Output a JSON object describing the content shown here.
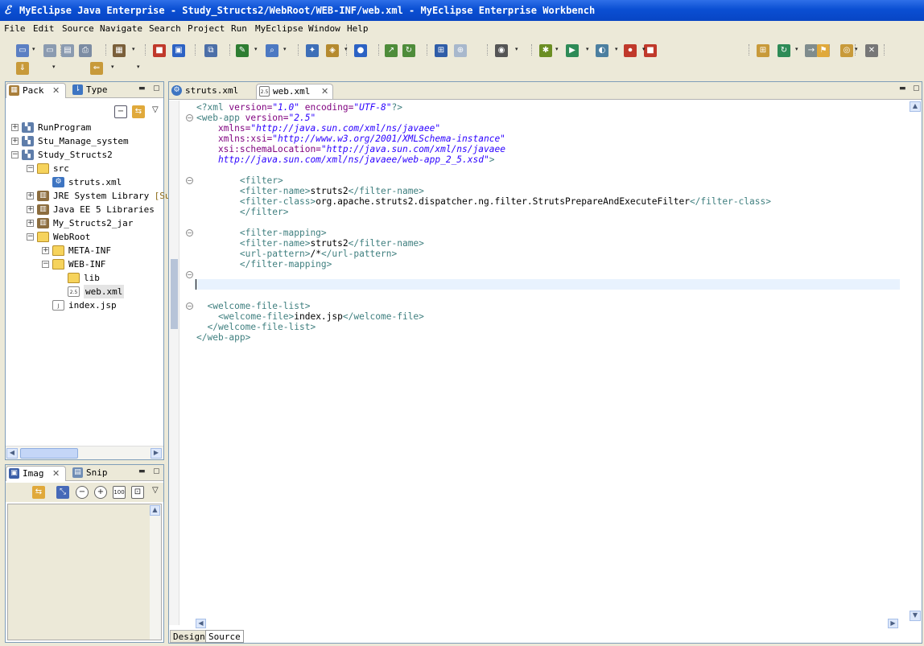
{
  "window": {
    "title": "MyEclipse Java Enterprise - Study_Structs2/WebRoot/WEB-INF/web.xml - MyEclipse Enterprise Workbench"
  },
  "menu": [
    "File",
    "Edit",
    "Source",
    "Navigate",
    "Search",
    "Project",
    "Run",
    "MyEclipse",
    "Window",
    "Help"
  ],
  "toolbar_icons": [
    "new-icon",
    "save-icon",
    "save-all-icon",
    "print-icon",
    "deploy-icon",
    "package-icon",
    "jar-icon",
    "server-icon",
    "debug-build-icon",
    "search-icon",
    "open-type-icon",
    "new-class-icon",
    "globe-icon",
    "open-resource-icon",
    "external-tools-icon",
    "properties-icon",
    "browser-icon",
    "camera-icon",
    "bug-debug-icon",
    "run-icon",
    "coverage-icon",
    "profile-icon",
    "stop-icon",
    "perspective-icon",
    "refresh-icon",
    "forward-icon",
    "back-icon",
    "open-folder-icon",
    "wizard-icon",
    "open-icon",
    "close-icon"
  ],
  "package_explorer": {
    "tabs": [
      {
        "label": "Pack",
        "icon": "package-explorer-icon"
      },
      {
        "label": "Type",
        "icon": "type-hierarchy-icon"
      }
    ],
    "tree": [
      {
        "label": "RunProgram",
        "level": 0,
        "expander": "+",
        "icon": "project-icon"
      },
      {
        "label": "Stu_Manage_system",
        "level": 0,
        "expander": "+",
        "icon": "project-icon"
      },
      {
        "label": "Study_Structs2",
        "level": 0,
        "expander": "-",
        "icon": "project-icon"
      },
      {
        "label": "src",
        "level": 1,
        "expander": "-",
        "icon": "source-folder-icon"
      },
      {
        "label": "struts.xml",
        "level": 2,
        "expander": "",
        "icon": "xml-gear-icon"
      },
      {
        "label": "JRE System Library",
        "suffix": "[Su",
        "level": 1,
        "expander": "+",
        "icon": "library-icon"
      },
      {
        "label": "Java EE 5 Libraries",
        "level": 1,
        "expander": "+",
        "icon": "library-icon"
      },
      {
        "label": "My_Structs2_jar",
        "level": 1,
        "expander": "+",
        "icon": "library-icon"
      },
      {
        "label": "WebRoot",
        "level": 1,
        "expander": "-",
        "icon": "folder-icon"
      },
      {
        "label": "META-INF",
        "level": 2,
        "expander": "+",
        "icon": "folder-icon"
      },
      {
        "label": "WEB-INF",
        "level": 2,
        "expander": "-",
        "icon": "folder-icon"
      },
      {
        "label": "lib",
        "level": 3,
        "expander": "",
        "icon": "folder-icon"
      },
      {
        "label": "web.xml",
        "level": 3,
        "expander": "",
        "icon": "web-xml-icon",
        "selected": true
      },
      {
        "label": "index.jsp",
        "level": 2,
        "expander": "",
        "icon": "jsp-file-icon"
      }
    ]
  },
  "image_panel": {
    "tabs": [
      {
        "label": "Imag",
        "icon": "image-view-icon"
      },
      {
        "label": "Snip",
        "icon": "snippets-icon"
      }
    ],
    "tools": [
      "link-icon",
      "fit-icon",
      "zoom-out-icon",
      "zoom-in-icon",
      "actual-size-icon",
      "fit-screen-icon",
      "view-menu-icon"
    ]
  },
  "editor": {
    "tabs": [
      {
        "label": "struts.xml",
        "icon": "xml-gear-icon",
        "active": false
      },
      {
        "label": "web.xml",
        "icon": "web-xml-icon",
        "active": true
      }
    ],
    "bottom_tabs": [
      {
        "label": "Design",
        "active": false
      },
      {
        "label": "Source",
        "active": true
      }
    ],
    "current_line": 17,
    "lines": [
      [
        {
          "t": "<?xml ",
          "c": "tag"
        },
        {
          "t": "version=",
          "c": "attr"
        },
        {
          "t": "\"1.0\"",
          "c": "val"
        },
        {
          "t": " encoding=",
          "c": "attr"
        },
        {
          "t": "\"UTF-8\"",
          "c": "val"
        },
        {
          "t": "?>",
          "c": "tag"
        }
      ],
      [
        {
          "t": "<web-app ",
          "c": "tag"
        },
        {
          "t": "version=",
          "c": "attr"
        },
        {
          "t": "\"2.5\"",
          "c": "val"
        }
      ],
      [
        {
          "t": "    xmlns=",
          "c": "attr"
        },
        {
          "t": "\"http://java.sun.com/xml/ns/javaee\"",
          "c": "val"
        }
      ],
      [
        {
          "t": "    xmlns:xsi=",
          "c": "attr"
        },
        {
          "t": "\"http://www.w3.org/2001/XMLSchema-instance\"",
          "c": "val"
        }
      ],
      [
        {
          "t": "    xsi:schemaLocation=",
          "c": "attr"
        },
        {
          "t": "\"http://java.sun.com/xml/ns/javaee",
          "c": "val"
        }
      ],
      [
        {
          "t": "    http://java.sun.com/xml/ns/javaee/web-app_2_5.xsd\"",
          "c": "val"
        },
        {
          "t": ">",
          "c": "tag"
        }
      ],
      [],
      [
        {
          "t": "        <filter>",
          "c": "tag"
        }
      ],
      [
        {
          "t": "        <filter-name>",
          "c": "tag"
        },
        {
          "t": "struts2",
          "c": ""
        },
        {
          "t": "</filter-name>",
          "c": "tag"
        }
      ],
      [
        {
          "t": "        <filter-class>",
          "c": "tag"
        },
        {
          "t": "org.apache.struts2.dispatcher.ng.filter.StrutsPrepareAndExecuteFilter",
          "c": ""
        },
        {
          "t": "</filter-class>",
          "c": "tag"
        }
      ],
      [
        {
          "t": "        </filter>",
          "c": "tag"
        }
      ],
      [],
      [
        {
          "t": "        <filter-mapping>",
          "c": "tag"
        }
      ],
      [
        {
          "t": "        <filter-name>",
          "c": "tag"
        },
        {
          "t": "struts2",
          "c": ""
        },
        {
          "t": "</filter-name>",
          "c": "tag"
        }
      ],
      [
        {
          "t": "        <url-pattern>",
          "c": "tag"
        },
        {
          "t": "/*",
          "c": ""
        },
        {
          "t": "</url-pattern>",
          "c": "tag"
        }
      ],
      [
        {
          "t": "        </filter-mapping>",
          "c": "tag"
        }
      ],
      [],
      [],
      [],
      [
        {
          "t": "  <welcome-file-list>",
          "c": "tag"
        }
      ],
      [
        {
          "t": "    <welcome-file>",
          "c": "tag"
        },
        {
          "t": "index.jsp",
          "c": ""
        },
        {
          "t": "</welcome-file>",
          "c": "tag"
        }
      ],
      [
        {
          "t": "  </welcome-file-list>",
          "c": "tag"
        }
      ],
      [
        {
          "t": "</web-app>",
          "c": "tag"
        }
      ]
    ]
  },
  "colors": {
    "tag": "#3F7F7F",
    "attr": "#7F007F",
    "val": "#2A00FF",
    "current_line": "#E8F2FE",
    "title_bar": "#0A4FD3"
  }
}
